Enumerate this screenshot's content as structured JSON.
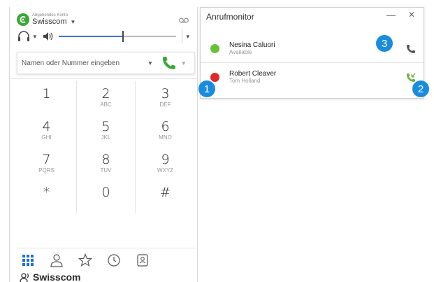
{
  "phone": {
    "account": {
      "caption": "Abgehendes Konto",
      "name": "Swisscom"
    },
    "dial_input": {
      "placeholder": "Namen oder Nummer eingeben",
      "value": ""
    },
    "volume": {
      "level": 0.55
    },
    "keypad": [
      [
        {
          "digit": "1",
          "letters": ""
        },
        {
          "digit": "2",
          "letters": "ABC"
        },
        {
          "digit": "3",
          "letters": "DEF"
        }
      ],
      [
        {
          "digit": "4",
          "letters": "GHI"
        },
        {
          "digit": "5",
          "letters": "JKL"
        },
        {
          "digit": "6",
          "letters": "MNO"
        }
      ],
      [
        {
          "digit": "7",
          "letters": "PQRS"
        },
        {
          "digit": "8",
          "letters": "TUV"
        },
        {
          "digit": "9",
          "letters": "WXYZ"
        }
      ],
      [
        {
          "digit": "*",
          "letters": ""
        },
        {
          "digit": "0",
          "letters": ""
        },
        {
          "digit": "#",
          "letters": ""
        }
      ]
    ],
    "bottom_nav": [
      "keypad-icon",
      "contacts-icon",
      "favorites-icon",
      "history-icon",
      "address-book-icon"
    ],
    "brand": "Swisscom"
  },
  "monitor": {
    "title": "Anrufmonitor",
    "calls": [
      {
        "name": "Nesina Caluori",
        "sub": "Available",
        "status": "available",
        "status_color": "#67c23a",
        "action_icon": "phone-icon"
      },
      {
        "name": "Robert Cleaver",
        "sub": "Tom Holland",
        "status": "busy",
        "status_color": "#e02a2a",
        "action_icon": "incoming-call-icon"
      }
    ]
  },
  "badges": [
    "1",
    "2",
    "3"
  ],
  "colors": {
    "accent": "#1a8cde",
    "green": "#3aa835",
    "slider": "#3b79cc"
  }
}
